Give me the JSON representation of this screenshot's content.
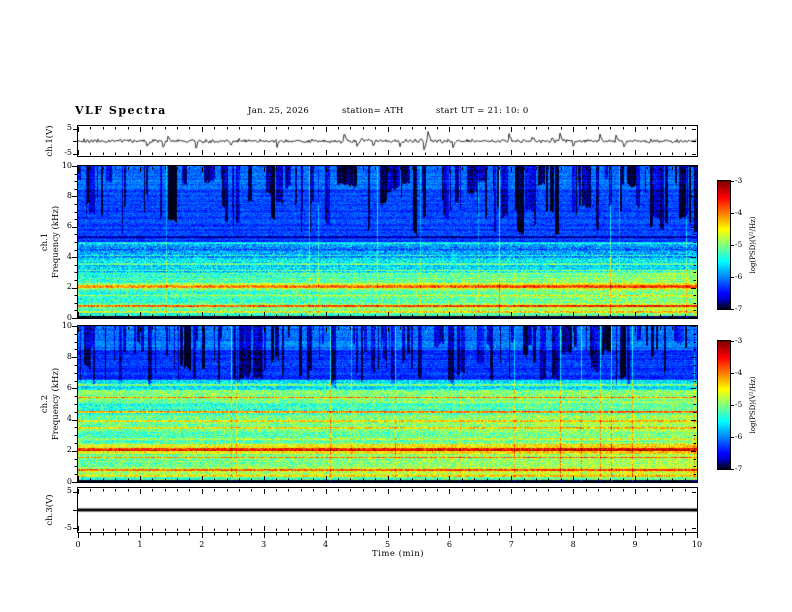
{
  "title": "VLF  Spectra",
  "header": {
    "date": "Jan. 25, 2026",
    "station": "station= ATH",
    "start_ut": "start UT =  21: 10: 0"
  },
  "time_axis": {
    "label": "Time  (min)",
    "min": 0,
    "max": 10,
    "major_tick_labels": [
      "0",
      "1",
      "2",
      "3",
      "4",
      "5",
      "6",
      "7",
      "8",
      "9",
      "10"
    ],
    "minor_step": 0.2
  },
  "colorbar": {
    "label": "log(PSD)(V²/Hz)",
    "tick_labels": [
      "-3",
      "-4",
      "-5",
      "-6",
      "-7"
    ],
    "vmax": -3,
    "vmin": -7,
    "colormap": "jet"
  },
  "chart_data": [
    {
      "id": "ch1_waveform",
      "type": "line",
      "channel_label": "ch.1(V)",
      "xlim": [
        0,
        10
      ],
      "ylim": [
        -6,
        6
      ],
      "yticks": [
        5,
        -5
      ],
      "ytick_labels": [
        "5",
        "-5"
      ],
      "signal": {
        "kind": "noise",
        "mean_v": 0,
        "noise_amp_v": 0.7,
        "spike_prob": 0.03,
        "spike_amp_v": 3.4,
        "color": "#000000",
        "seed": 20
      }
    },
    {
      "id": "ch1_spectrogram",
      "type": "heatmap",
      "channel_label": "ch.1",
      "ylabel": "Frequency (kHz)",
      "xlim": [
        0,
        10
      ],
      "ylim": [
        0,
        10
      ],
      "yticks": [
        0,
        2,
        4,
        6,
        8,
        10
      ],
      "zlim": [
        -7,
        -3
      ],
      "colormap": "jet",
      "seed": 7,
      "noise_amp": 0.42,
      "bands": [
        [
          8.5,
          10.01,
          -6.05
        ],
        [
          5.0,
          8.5,
          -6.25
        ],
        [
          4.0,
          5.0,
          -5.9
        ],
        [
          3.0,
          4.0,
          -5.6
        ],
        [
          2.35,
          3.0,
          -5.2
        ],
        [
          1.85,
          2.35,
          -4.85
        ],
        [
          1.0,
          1.85,
          -5.25
        ],
        [
          0.5,
          1.0,
          -5.0
        ],
        [
          0.18,
          0.5,
          -5.4
        ],
        [
          0,
          0.18,
          -7.2
        ]
      ],
      "lines": [
        [
          5.35,
          0.06,
          -0.5
        ],
        [
          4.95,
          0.05,
          0.55
        ],
        [
          4.55,
          0.05,
          -0.45
        ],
        [
          4.15,
          0.04,
          0.5
        ],
        [
          3.6,
          0.05,
          0.5
        ],
        [
          3.15,
          0.04,
          0.4
        ],
        [
          2.1,
          0.12,
          0.8
        ],
        [
          1.5,
          0.05,
          0.4
        ],
        [
          0.8,
          0.06,
          1.1
        ],
        [
          0.42,
          0.05,
          0.85
        ]
      ],
      "streaks": {
        "fmin_range": [
          5.5,
          9.2
        ],
        "density": 0.5,
        "darken": [
          -0.55,
          -1.3
        ],
        "bright_prob": 0.02,
        "bright": [
          0.3,
          0.8
        ]
      },
      "ramp": {
        "fmax": 3.2,
        "amount": 0.45
      }
    },
    {
      "id": "ch2_spectrogram",
      "type": "heatmap",
      "channel_label": "ch.2",
      "ylabel": "Frequency (kHz)",
      "xlim": [
        0,
        10
      ],
      "ylim": [
        0,
        10
      ],
      "yticks": [
        0,
        2,
        4,
        6,
        8,
        10
      ],
      "zlim": [
        -7,
        -3
      ],
      "colormap": "jet",
      "seed": 13,
      "noise_amp": 0.42,
      "bands": [
        [
          8.5,
          10.01,
          -6.05
        ],
        [
          6.6,
          8.5,
          -6.3
        ],
        [
          5.9,
          6.6,
          -5.55
        ],
        [
          5.1,
          5.9,
          -5.0
        ],
        [
          4.3,
          5.1,
          -5.35
        ],
        [
          3.3,
          4.3,
          -5.0
        ],
        [
          2.45,
          3.3,
          -5.2
        ],
        [
          1.85,
          2.45,
          -4.55
        ],
        [
          1.0,
          1.85,
          -5.0
        ],
        [
          0.5,
          1.0,
          -4.85
        ],
        [
          0.18,
          0.5,
          -5.2
        ],
        [
          0,
          0.18,
          -7.2
        ]
      ],
      "lines": [
        [
          6.25,
          0.05,
          0.5
        ],
        [
          5.45,
          0.06,
          0.9
        ],
        [
          4.5,
          0.06,
          1.2
        ],
        [
          3.95,
          0.05,
          0.65
        ],
        [
          3.5,
          0.05,
          0.55
        ],
        [
          2.8,
          0.05,
          0.45
        ],
        [
          2.1,
          0.11,
          1.0
        ],
        [
          1.6,
          0.06,
          0.9
        ],
        [
          0.8,
          0.06,
          1.05
        ],
        [
          0.4,
          0.05,
          0.75
        ]
      ],
      "streaks": {
        "fmin_range": [
          6.2,
          9.3
        ],
        "density": 0.5,
        "darken": [
          -0.55,
          -1.2
        ],
        "bright_prob": 0.02,
        "bright": [
          0.3,
          0.8
        ]
      },
      "ramp": {
        "fmax": 5.2,
        "amount": 0.3
      }
    },
    {
      "id": "ch3_waveform",
      "type": "line",
      "channel_label": "ch.3(V)",
      "xlim": [
        0,
        10
      ],
      "ylim": [
        -6,
        6
      ],
      "yticks": [
        5,
        -5
      ],
      "ytick_labels": [
        "5",
        "-5"
      ],
      "signal": {
        "kind": "flat",
        "value_v": 0,
        "thickness_px": 3,
        "color": "#000000"
      }
    }
  ]
}
